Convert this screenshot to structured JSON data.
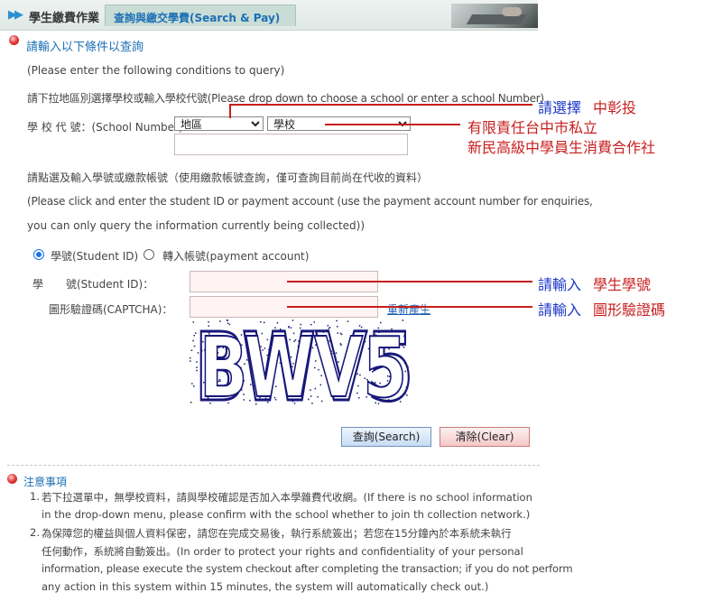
{
  "header": {
    "title": "學生繳費作業",
    "tab": "查詢與繳交學費(Search & Pay)"
  },
  "query": {
    "section_title": "請輸入以下條件以查詢",
    "instruction_en": "(Please enter the following conditions to query)",
    "school_instruction": "請下拉地區別選擇學校或輸入學校代號(Please drop down to choose a school or enter a school Number)",
    "school_number_label": "學 校 代 號：(School Number)",
    "region_selected": "地區",
    "school_selected": "學校",
    "account_instruction_zh": "請點選及輸入學號或繳款帳號（使用繳款帳號查詢，僅可查詢目前尚在代收的資料）",
    "account_instruction_en_1": "(Please click and enter the student ID or payment account (use the payment account number for enquiries,",
    "account_instruction_en_2": "you can only query the information currently being collected))",
    "radio_student_id": "學號(Student ID)",
    "radio_payment_account": "轉入帳號(payment account)",
    "student_id_label_1": "學",
    "student_id_label_2": "號(Student ID)：",
    "captcha_label": "圖形驗證碼(CAPTCHA)：",
    "refresh_link": "重新產生",
    "captcha_text": "BWV5",
    "search_button": "查詢(Search)",
    "clear_button": "清除(Clear)"
  },
  "annotations": {
    "select_school_prefix": "請選擇",
    "select_school_value": "中彰投",
    "school_name_line1": "有限責任台中市私立",
    "school_name_line2": "新民高級中學員生消費合作社",
    "enter_prefix_1": "請輸入",
    "enter_student_id": "學生學號",
    "enter_prefix_2": "請輸入",
    "enter_captcha": "圖形驗證碼"
  },
  "notes": {
    "title": "注意事項",
    "items": [
      {
        "num": "1.",
        "lines": [
          "若下拉選單中，無學校資料，請與學校確認是否加入本學雜費代收網。(If there is no school information",
          "in the drop-down menu, please confirm with the school whether to join th collection network.)"
        ]
      },
      {
        "num": "2.",
        "lines": [
          "為保障您的權益與個人資料保密，請您在完成交易後，執行系統簽出；若您在15分鐘內於本系統未執行",
          "任何動作，系統將自動簽出。(In order to protect your rights and confidentiality of your personal",
          "information, please execute the system checkout after completing the transaction; if you do not perform",
          "any action in this system within 15 minutes, the system will automatically check out.)"
        ]
      }
    ]
  },
  "colors": {
    "accent_blue": "#1c6fb4",
    "annotation_red": "#c81e1e",
    "annotation_blue": "#1a36c8"
  }
}
